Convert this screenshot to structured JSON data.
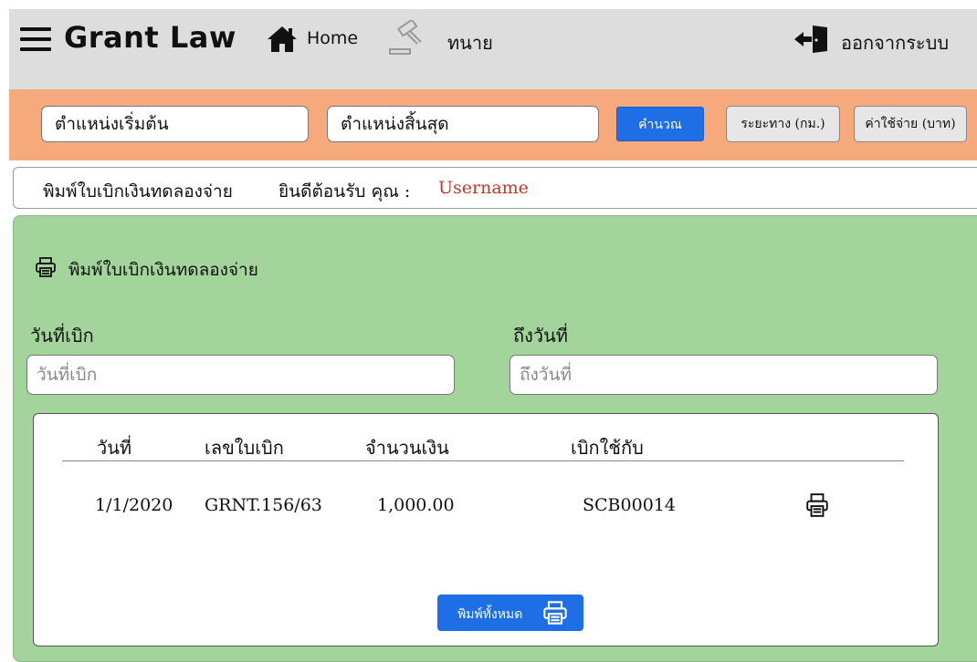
{
  "header": {
    "brand": "Grant Law",
    "home_label": "Home",
    "lawyer_label": "ทนาย",
    "logout_label": "ออกจากระบบ"
  },
  "calc_bar": {
    "start_value": "ตำแหน่งเริ่มต้น",
    "end_value": "ตำแหน่งสิ้นสุด",
    "calc_button": "คำนวณ",
    "distance_label": "ระยะทาง (กม.)",
    "cost_label": "ค่าใช้จ่าย (บาท)"
  },
  "welcome": {
    "page_name": "พิมพ์ใบเบิกเงินทดลองจ่าย",
    "greeting": "ยินดีต้อนรับ คุณ :",
    "username": "Username"
  },
  "panel": {
    "title": "พิมพ์ใบเบิกเงินทดลองจ่าย",
    "date_from_label": "วันที่เบิก",
    "date_from_placeholder": "วันที่เบิก",
    "date_to_label": "ถึงวันที่",
    "date_to_placeholder": "ถึงวันที่"
  },
  "table": {
    "columns": [
      "วันที่",
      "เลขใบเบิก",
      "จำนวนเงิน",
      "เบิกใช้กับ"
    ],
    "rows": [
      {
        "date": "1/1/2020",
        "number": "GRNT.156/63",
        "amount": "1,000.00",
        "used_for": "SCB00014"
      }
    ],
    "print_all_button": "พิมพ์ทั้งหมด"
  },
  "colors": {
    "topbar": "#dddddd",
    "orange_bar": "#f6a97c",
    "panel_green": "#a3d49b",
    "primary_blue": "#1e6ee6",
    "username_red": "#c0392b"
  },
  "icons": [
    "menu-icon",
    "home-icon",
    "gavel-icon",
    "logout-icon",
    "printer-icon"
  ]
}
